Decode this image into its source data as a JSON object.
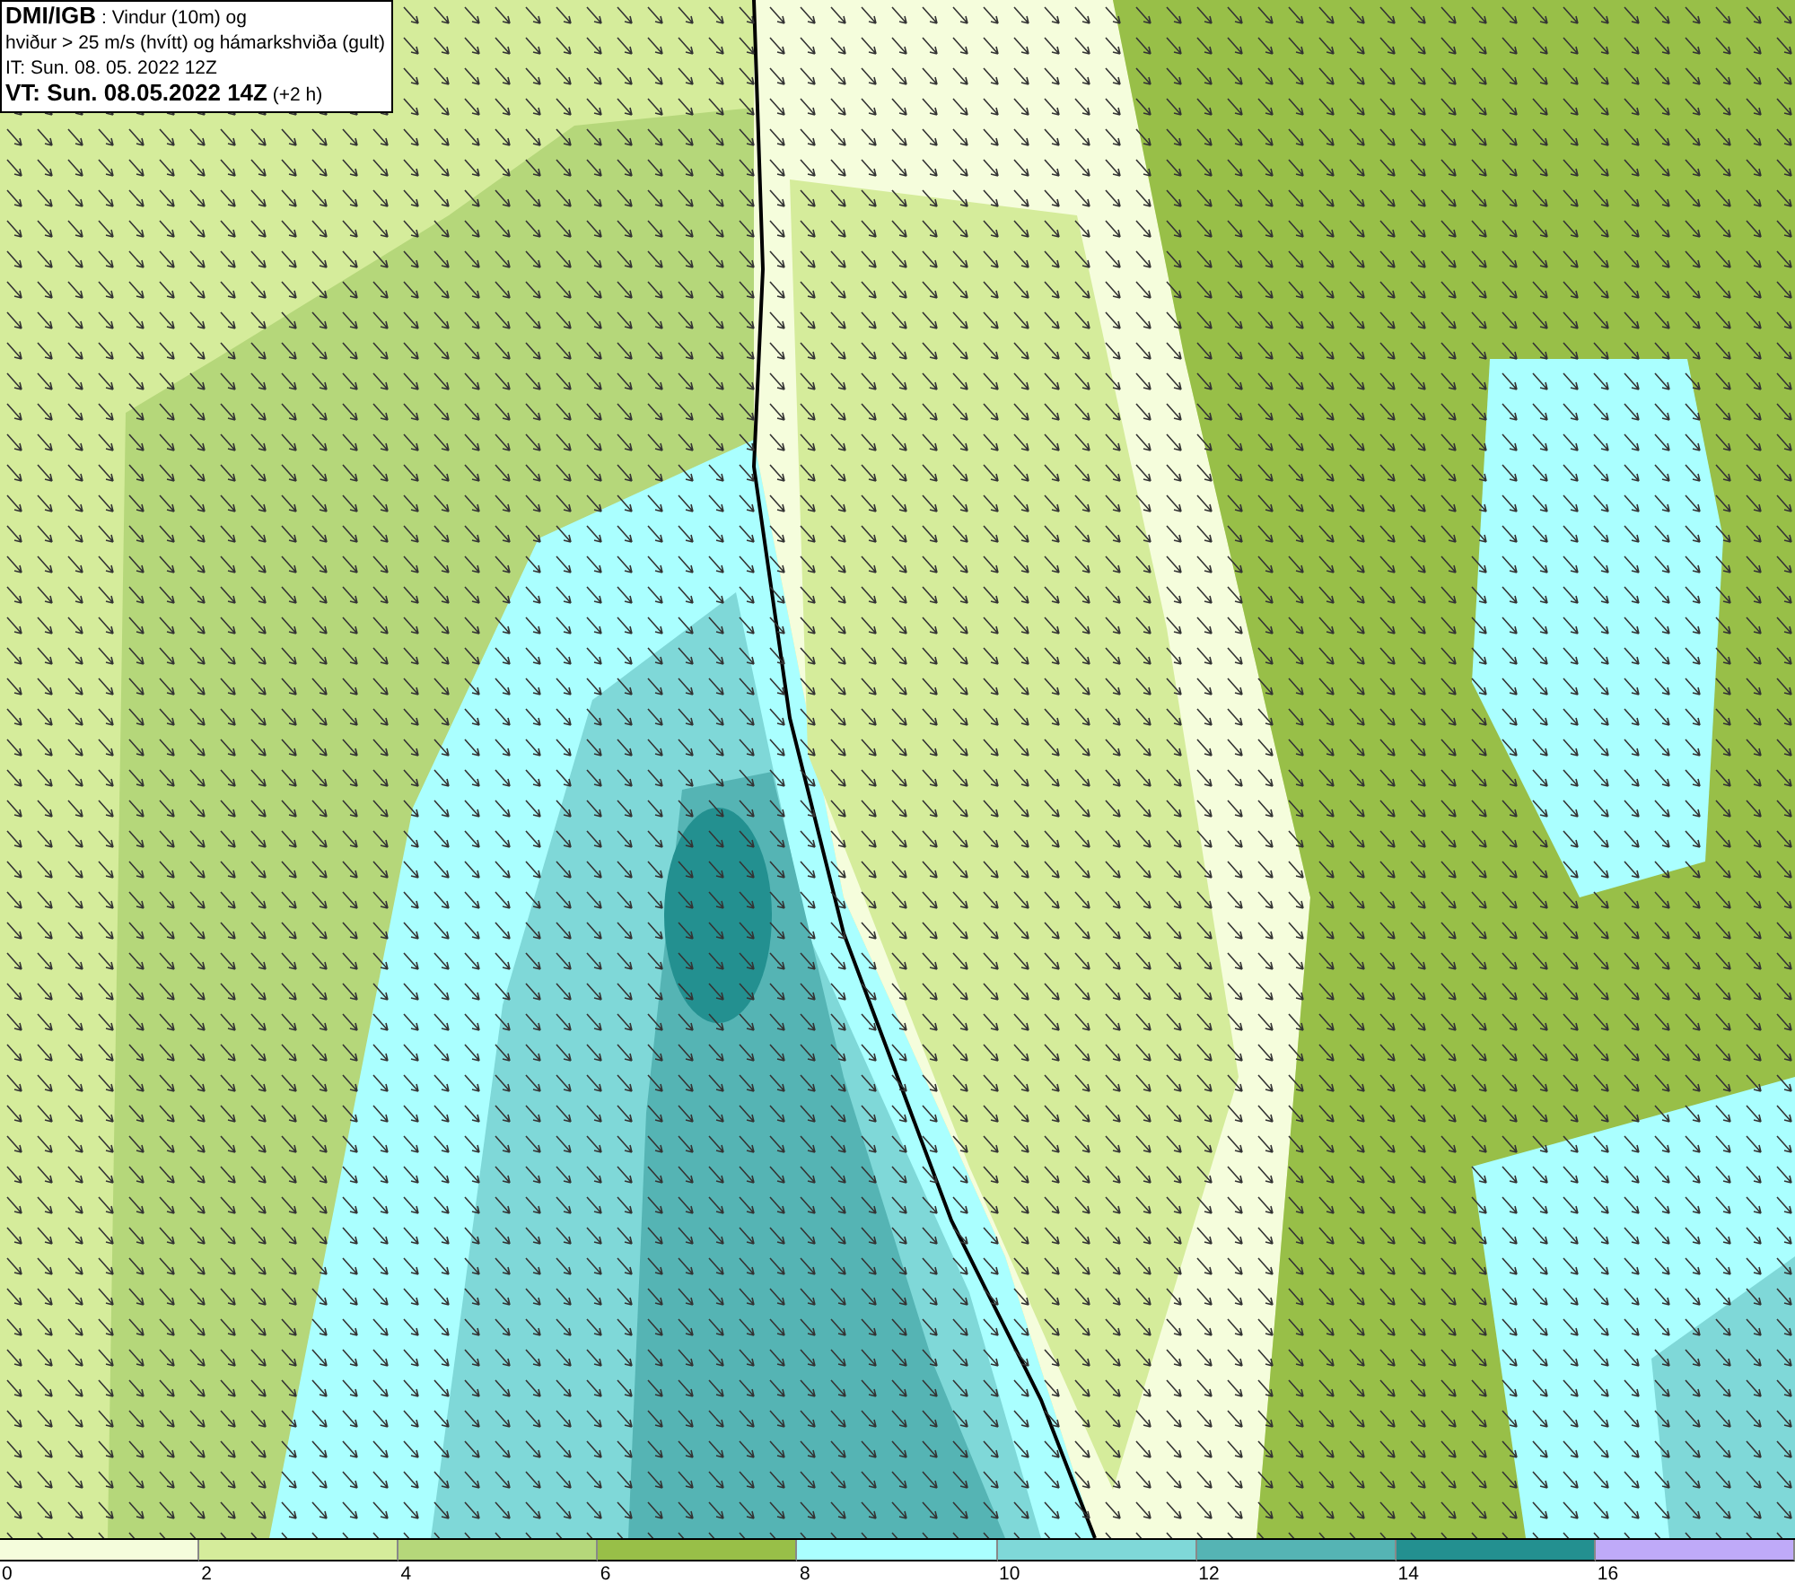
{
  "info_box": {
    "lines": [
      "**DMI/IGB** : Vindur (10m) og",
      "hviður > 25 m/s (hvítt) og hámarkshviða (gult)",
      "IT: Sun. 08. 05. 2022 12Z",
      "**VT: Sun. 08.05.2022 14Z** (+2 h)"
    ]
  },
  "legend": {
    "bins": [
      {
        "color": "#f5fddc",
        "label": "0"
      },
      {
        "color": "#d5ec9b",
        "label": "2"
      },
      {
        "color": "#b5d77a",
        "label": "4"
      },
      {
        "color": "#98bf48",
        "label": "6"
      },
      {
        "color": "#aaffff",
        "label": "8"
      },
      {
        "color": "#7fd8d8",
        "label": "10"
      },
      {
        "color": "#55b4b4",
        "label": "12"
      },
      {
        "color": "#239090",
        "label": "14"
      },
      {
        "color": "#bfaaf8",
        "label": "16"
      }
    ]
  }
}
